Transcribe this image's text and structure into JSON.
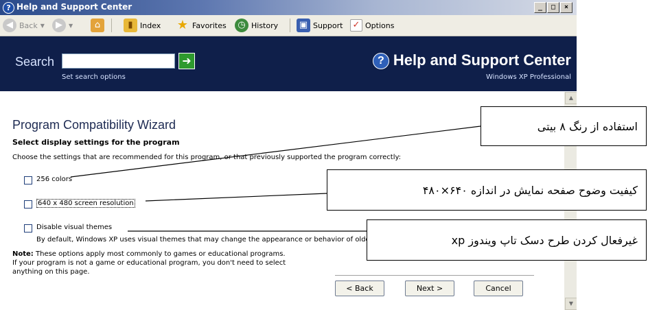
{
  "window": {
    "title": "Help and Support Center",
    "controls": {
      "minimize": "_",
      "maximize": "□",
      "close": "×"
    }
  },
  "toolbar": {
    "back": "Back",
    "index": "Index",
    "favorites": "Favorites",
    "history": "History",
    "support": "Support",
    "options": "Options"
  },
  "header": {
    "search_label": "Search",
    "search_value": "",
    "search_options": "Set search options",
    "app_title": "Help and Support Center",
    "edition": "Windows XP Professional"
  },
  "content": {
    "title": "Program Compatibility Wizard",
    "subtitle": "Select display settings for the program",
    "instructions": "Choose the settings that are recommended for this program, or that previously supported the program correctly:",
    "options": [
      {
        "label": "256 colors",
        "checked": false
      },
      {
        "label": "640 x 480 screen resolution",
        "checked": false
      },
      {
        "label": "Disable visual themes",
        "checked": false
      }
    ],
    "themes_description": "By default, Windows XP uses visual themes that may change the appearance or behavior of older programs.",
    "note_label": "Note:",
    "note_text": "These options apply most commonly to games or educational programs. If your program is not a game or educational program, you don't need to select anything on this page."
  },
  "buttons": {
    "back": "< Back",
    "next": "Next >",
    "cancel": "Cancel"
  },
  "callouts": [
    "استفاده از رنگ ۸ بیتی",
    "کیفیت وضوح صفحه نمایش در اندازه ۶۴۰×۴۸۰",
    "غیرفعال کردن طرح دسک تاپ ویندوز xp"
  ],
  "colors": {
    "header_bg": "#0f1f4a",
    "title_bar": "#2a4a8a",
    "go_button": "#2e9a2e"
  },
  "icons": [
    "help-icon",
    "back-arrow-icon",
    "forward-arrow-icon",
    "home-icon",
    "index-book-icon",
    "favorites-star-icon",
    "history-clock-icon",
    "support-icon",
    "options-check-icon",
    "go-arrow-icon"
  ]
}
